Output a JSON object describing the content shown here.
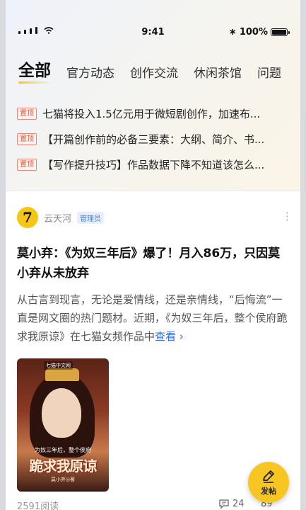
{
  "status_bar": {
    "time": "9:41",
    "battery": "100%",
    "bluetooth_icon": "bluetooth-icon"
  },
  "tabs": [
    {
      "label": "全部",
      "active": true
    },
    {
      "label": "官方动态"
    },
    {
      "label": "创作交流"
    },
    {
      "label": "休闲茶馆"
    },
    {
      "label": "问题"
    }
  ],
  "pinned": {
    "badge": "置顶",
    "items": [
      "七猫将投入1.5亿元用于微短剧创作，加速布...",
      "【开篇创作前的必备三要素：大纲、简介、书...",
      "【写作提升技巧】作品数据下降不知道该怎么..."
    ]
  },
  "post": {
    "author": "云天河",
    "role": "管理员",
    "avatar_letter": "7",
    "title": "莫小弃：《为奴三年后》爆了！月入86万，只因莫小弃从未放弃",
    "body": "从古言到现言，无论是爱情线，还是亲情线，“后悔流”一直是网文圈的热门题材。近期，《为奴三年后，整个侯府跪求我原谅》在七猫女频作品中",
    "more_link": "查看 ›",
    "cover": {
      "logo": "七猫中文网",
      "subtitle": "为奴三年后，整个侯府",
      "title": "跪求我原谅",
      "author": "莫小弃◎著"
    },
    "reads": "2591阅读",
    "comments": "24",
    "likes": "89"
  },
  "fab": {
    "label": "发帖"
  },
  "colors": {
    "accent": "#f7c623",
    "link": "#3d6ad6",
    "badge": "#e2543a"
  }
}
